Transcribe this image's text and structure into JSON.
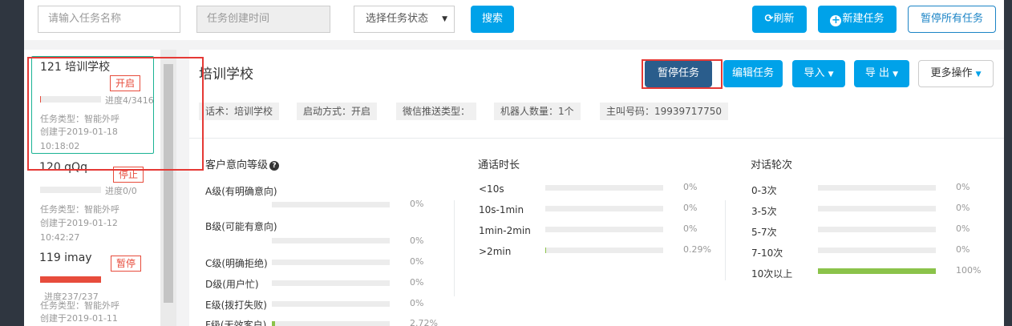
{
  "toolbar": {
    "task_name_placeholder": "请输入任务名称",
    "created_time_placeholder": "任务创建时间",
    "status_select": "选择任务状态",
    "search_label": "搜索",
    "refresh_label": "刷新",
    "new_task_label": "新建任务",
    "pause_all_label": "暂停所有任务"
  },
  "tasks": [
    {
      "title": "121 培训学校",
      "status": "开启",
      "progress": "进度4/3416",
      "progress_value": 0.0012,
      "type": "任务类型：智能外呼",
      "created_line1": "创建于2019-01-18",
      "created_line2": "10:18:02"
    },
    {
      "title": "120 qQq",
      "status": "停止",
      "progress": "进度0/0",
      "progress_value": 0,
      "type": "任务类型：智能外呼",
      "created_line1": "创建于2019-01-12",
      "created_line2": "10:42:27"
    },
    {
      "title": "119 imay",
      "status": "暂停",
      "progress": "进度237/237",
      "progress_value": 1,
      "type": "任务类型：智能外呼",
      "created_line1": "创建于2019-01-11",
      "created_line2": ""
    }
  ],
  "detail": {
    "title": "培训学校",
    "actions": {
      "pause": "暂停任务",
      "edit": "编辑任务",
      "import": "导入",
      "export": "导 出",
      "more": "更多操作"
    },
    "chips": [
      "话术：培训学校",
      "启动方式：开启",
      "微信推送类型：",
      "机器人数量：1个",
      "主叫号码：19939717750"
    ]
  },
  "intent": {
    "title": "客户意向等级",
    "rows": [
      {
        "label": "A级(有明确意向)",
        "pct": "0%",
        "value": 0
      },
      {
        "label": "B级(可能有意向)",
        "pct": "0%",
        "value": 0
      },
      {
        "label": "C级(明确拒绝)",
        "pct": "0%",
        "value": 0
      },
      {
        "label": "D级(用户忙)",
        "pct": "0%",
        "value": 0
      },
      {
        "label": "E级(拨打失败)",
        "pct": "0%",
        "value": 0
      },
      {
        "label": "F级(无效客户)",
        "pct": "2.72%",
        "value": 0.0272
      }
    ]
  },
  "duration": {
    "title": "通话时长",
    "rows": [
      {
        "label": "<10s",
        "pct": "0%",
        "value": 0
      },
      {
        "label": "10s-1min",
        "pct": "0%",
        "value": 0
      },
      {
        "label": "1min-2min",
        "pct": "0%",
        "value": 0
      },
      {
        "label": ">2min",
        "pct": "0.29%",
        "value": 0.0029
      }
    ]
  },
  "rounds": {
    "title": "对话轮次",
    "rows": [
      {
        "label": "0-3次",
        "pct": "0%",
        "value": 0
      },
      {
        "label": "3-5次",
        "pct": "0%",
        "value": 0
      },
      {
        "label": "5-7次",
        "pct": "0%",
        "value": 0
      },
      {
        "label": "7-10次",
        "pct": "0%",
        "value": 0
      },
      {
        "label": "10次以上",
        "pct": "100%",
        "value": 1
      }
    ]
  },
  "colors": {
    "primary": "#00a2e9",
    "dark_button": "#2a5d8c",
    "danger": "#e74c3c",
    "bar_fill": "#8bc34a",
    "highlight": "#e53935"
  }
}
